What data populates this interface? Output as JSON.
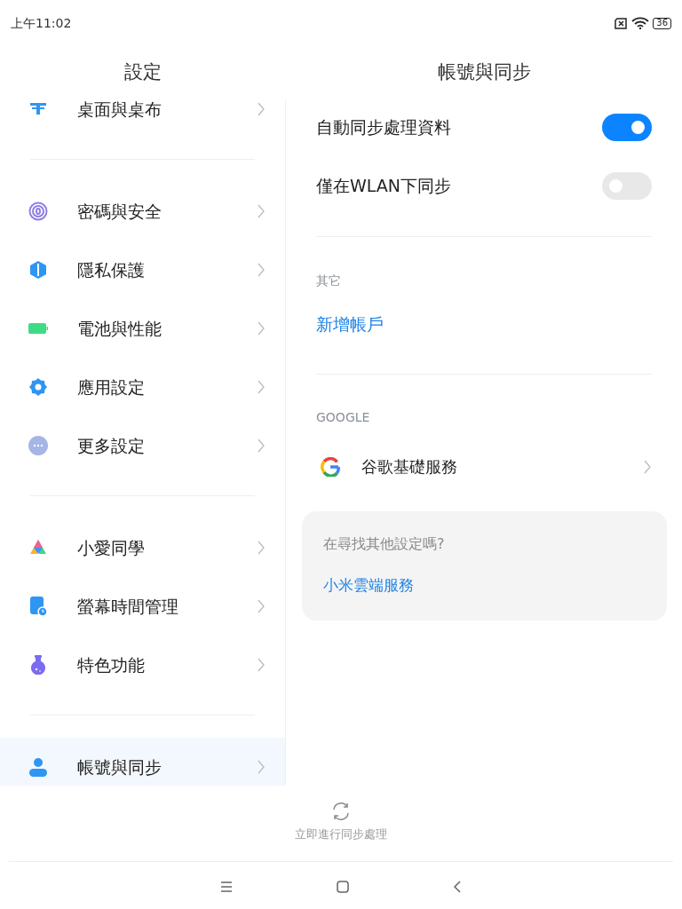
{
  "status_bar": {
    "time": "上午11:02",
    "battery": "36"
  },
  "settings_pane": {
    "title": "設定",
    "groups": [
      [
        {
          "label": "桌面與桌布",
          "kind": "wallpaper",
          "selected": false
        }
      ],
      [
        {
          "label": "密碼與安全",
          "kind": "fingerprint",
          "selected": false
        },
        {
          "label": "隱私保護",
          "kind": "privacy",
          "selected": false
        },
        {
          "label": "電池與性能",
          "kind": "battery",
          "selected": false
        },
        {
          "label": "應用設定",
          "kind": "gear",
          "selected": false
        },
        {
          "label": "更多設定",
          "kind": "more",
          "selected": false
        }
      ],
      [
        {
          "label": "小愛同學",
          "kind": "assistant",
          "selected": false
        },
        {
          "label": "螢幕時間管理",
          "kind": "screentime",
          "selected": false
        },
        {
          "label": "特色功能",
          "kind": "flask",
          "selected": false
        }
      ],
      [
        {
          "label": "帳號與同步",
          "kind": "person",
          "selected": true
        }
      ]
    ]
  },
  "detail_pane": {
    "title": "帳號與同步",
    "toggles": [
      {
        "label": "自動同步處理資料",
        "on": true
      },
      {
        "label": "僅在WLAN下同步",
        "on": false
      }
    ],
    "other_section": {
      "header": "其它",
      "link": "新增帳戶"
    },
    "google_section": {
      "header": "GOOGLE",
      "item": "谷歌基礎服務"
    },
    "help_card": {
      "question": "在尋找其他設定嗎?",
      "link": "小米雲端服務"
    }
  },
  "sync_button": {
    "label": "立即進行同步處理"
  }
}
